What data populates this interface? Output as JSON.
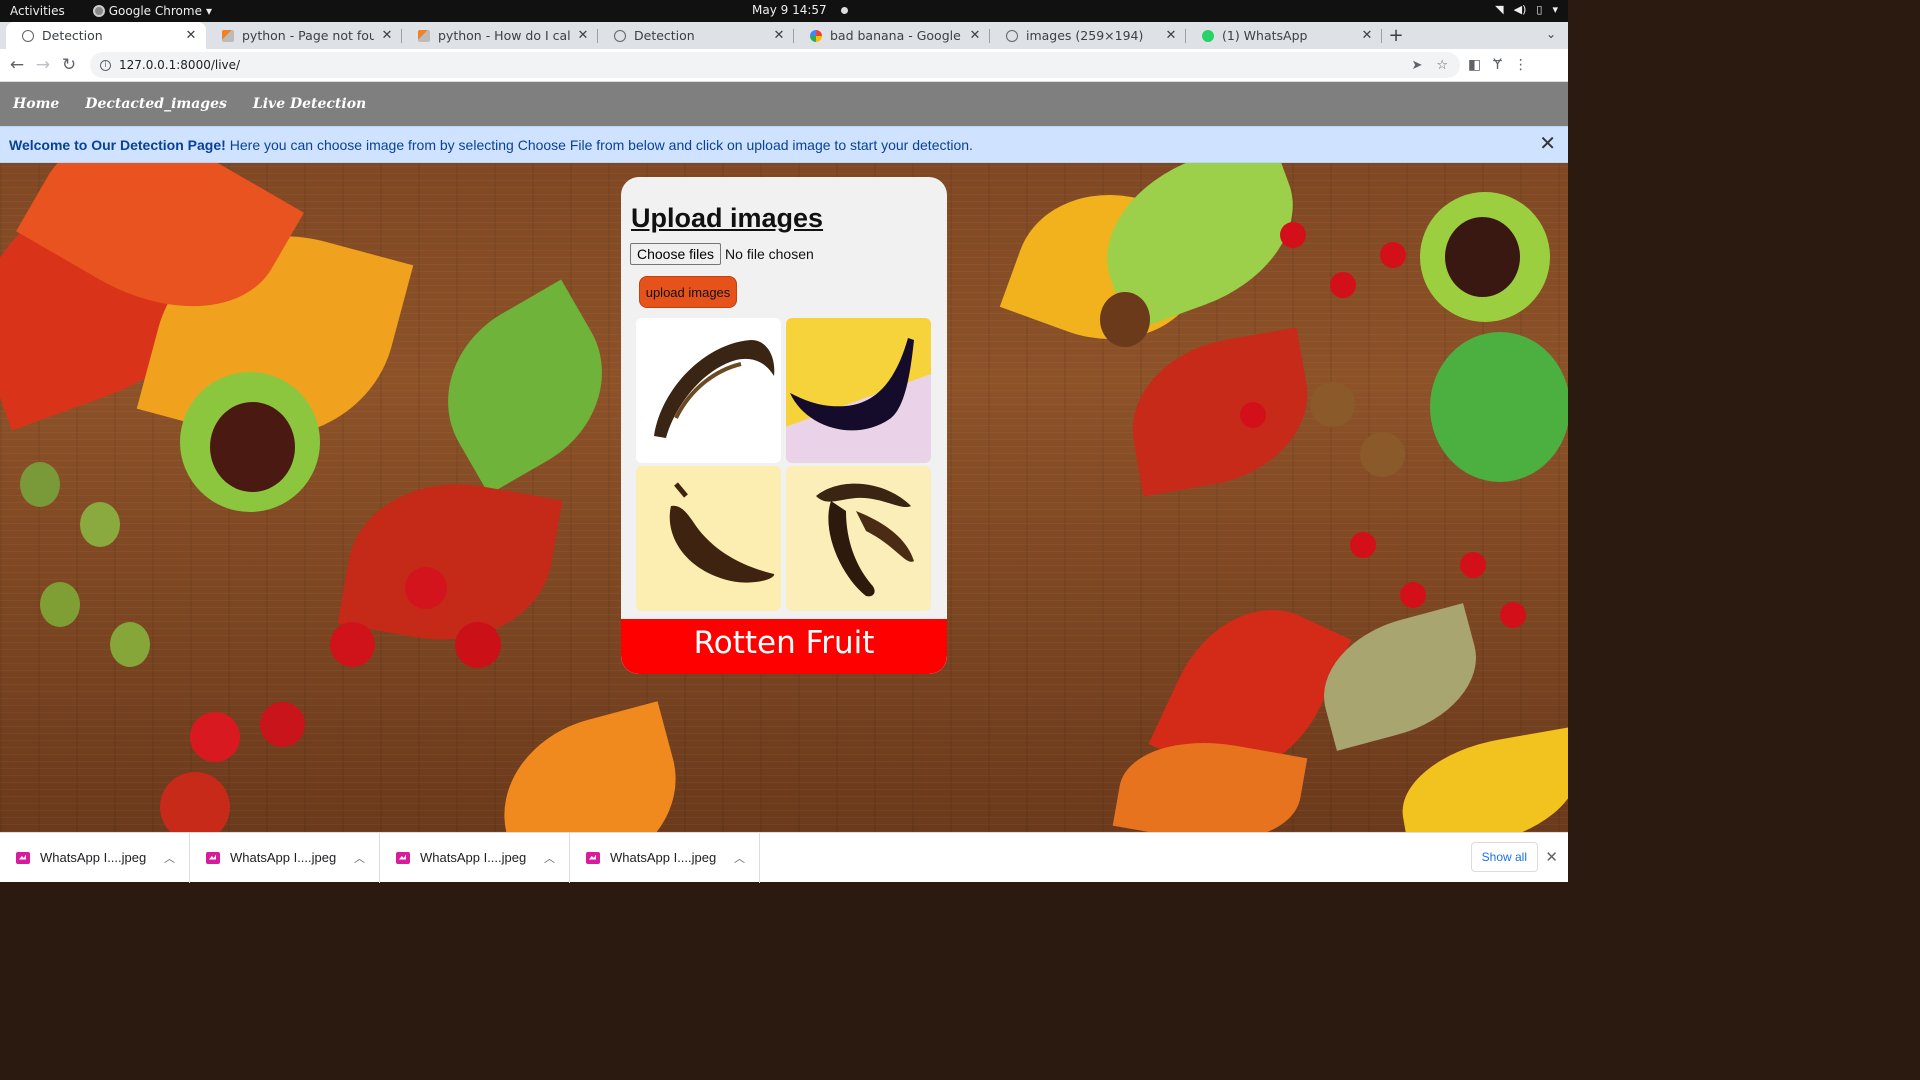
{
  "system": {
    "activities": "Activities",
    "app_name": "Google Chrome",
    "clock": "May 9  14:57"
  },
  "tabs": [
    {
      "title": "Detection",
      "icon": "globe-icon",
      "active": true
    },
    {
      "title": "python - Page not found (",
      "icon": "stackoverflow-icon"
    },
    {
      "title": "python - How do I call a Dj",
      "icon": "stackoverflow-icon"
    },
    {
      "title": "Detection",
      "icon": "globe-icon"
    },
    {
      "title": "bad banana - Google Sear",
      "icon": "google-icon"
    },
    {
      "title": "images (259×194)",
      "icon": "globe-icon"
    },
    {
      "title": "(1) WhatsApp",
      "icon": "whatsapp-icon"
    }
  ],
  "toolbar": {
    "url": "127.0.0.1:8000/live/"
  },
  "site_nav": {
    "home": "Home",
    "detected_images": "Dectacted_images",
    "live_detection": "Live Detection"
  },
  "alert": {
    "strong": "Welcome to Our Detection Page!",
    "message": "Here you can choose image from by selecting Choose File from below and click on upload image to start your detection."
  },
  "card": {
    "heading": "Upload images",
    "choose_files": "Choose files",
    "no_file": "No file chosen",
    "upload_button": "upload images",
    "result": "Rotten Fruit"
  },
  "downloads": [
    {
      "name": "WhatsApp I....jpeg"
    },
    {
      "name": "WhatsApp I....jpeg"
    },
    {
      "name": "WhatsApp I....jpeg"
    },
    {
      "name": "WhatsApp I....jpeg"
    }
  ],
  "shelf": {
    "show_all": "Show all"
  },
  "colors": {
    "nav_bg": "#7f7f7f",
    "alert_bg": "#cfe2ff",
    "upload_button": "#e5531a",
    "result_bg": "#ff0000"
  }
}
